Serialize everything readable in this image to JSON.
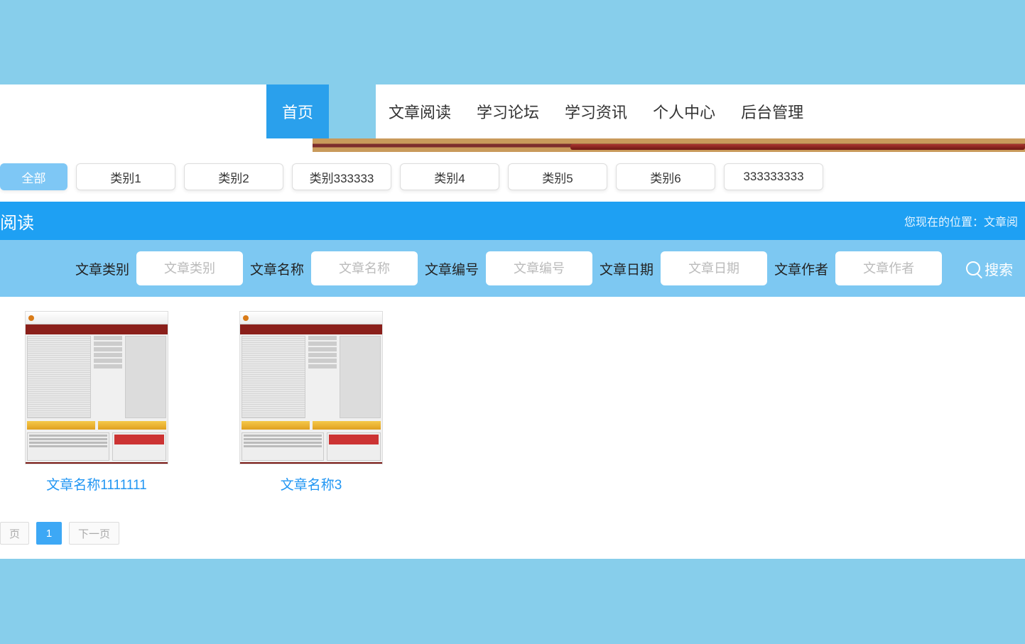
{
  "nav": {
    "home": "首页",
    "items": [
      "文章阅读",
      "学习论坛",
      "学习资讯",
      "个人中心",
      "后台管理"
    ]
  },
  "categories": {
    "all": "全部",
    "list": [
      "类别1",
      "类别2",
      "类别333333",
      "类别4",
      "类别5",
      "类别6",
      "333333333"
    ]
  },
  "page_head": {
    "title": "阅读",
    "breadcrumb_prefix": "您现在的位置：",
    "breadcrumb_page": "文章阅"
  },
  "filters": {
    "category": {
      "label": "文章类别",
      "placeholder": "文章类别"
    },
    "name": {
      "label": "文章名称",
      "placeholder": "文章名称"
    },
    "number": {
      "label": "文章编号",
      "placeholder": "文章编号"
    },
    "date": {
      "label": "文章日期",
      "placeholder": "文章日期"
    },
    "author": {
      "label": "文章作者",
      "placeholder": "文章作者"
    },
    "search": "搜索"
  },
  "cards": [
    {
      "title": "文章名称1111111"
    },
    {
      "title": "文章名称3"
    }
  ],
  "pager": {
    "prev": "页",
    "current": "1",
    "next": "下一页"
  }
}
